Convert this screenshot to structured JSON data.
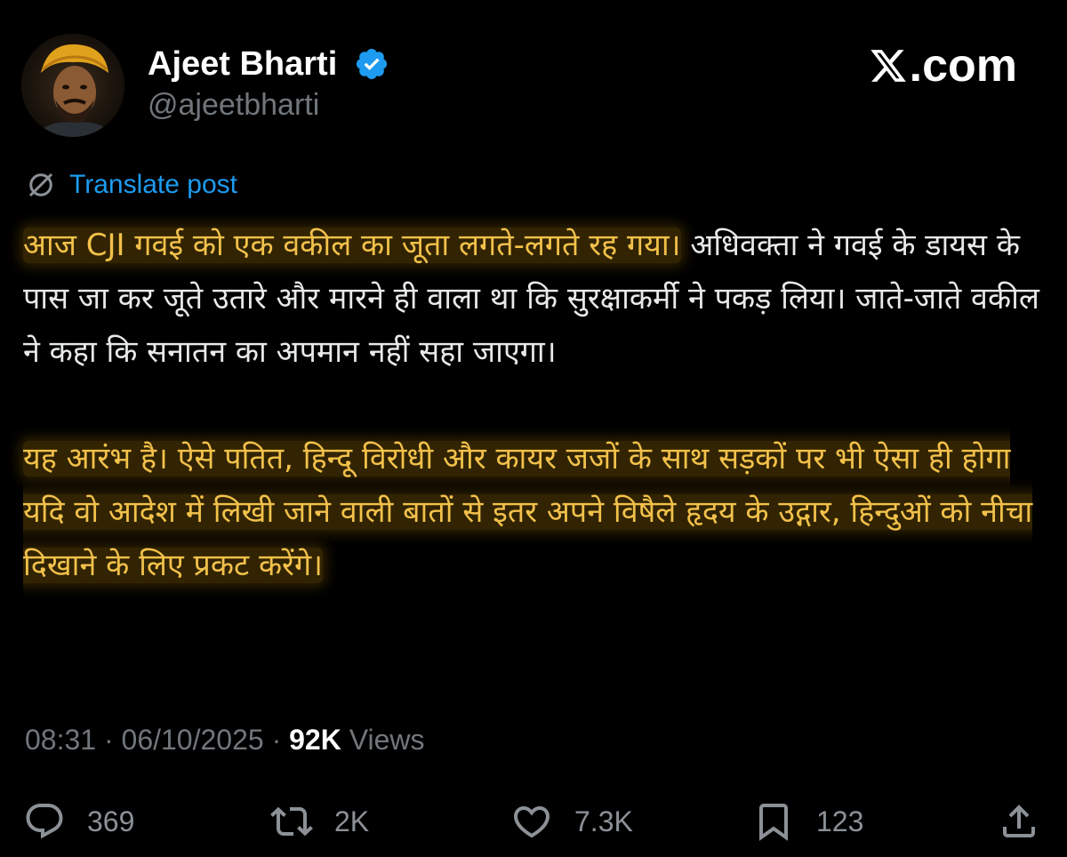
{
  "author": {
    "name": "Ajeet Bharti",
    "handle": "@ajeetbharti"
  },
  "brand": {
    "text": ".com"
  },
  "translate": {
    "label": "Translate post"
  },
  "post": {
    "para1": {
      "highlight": "आज CJI गवई को एक वकील का जूता लगते-लगते रह गया।",
      "rest": " अधिवक्ता ने गवई के डायस के पास जा कर जूते उतारे और मारने ही वाला था कि सुरक्षाकर्मी ने पकड़ लिया। जाते-जाते वकील ने कहा कि सनातन का अपमान नहीं सहा जाएगा।"
    },
    "para2": {
      "highlight": "यह आरंभ है। ऐसे पतित, हिन्दू विरोधी और कायर जजों के साथ सड़कों पर भी ऐसा ही होगा यदि वो आदेश में लिखी जाने वाली बातों से इतर अपने विषैले हृदय के उद्गार, हिन्दुओं को नीचा दिखाने के लिए प्रकट करेंगे।"
    }
  },
  "meta": {
    "time": "08:31",
    "separator": " · ",
    "date": "06/10/2025",
    "views_count": "92K",
    "views_label": " Views"
  },
  "actions": {
    "replies": "369",
    "reposts": "2K",
    "likes": "7.3K",
    "bookmarks": "123"
  },
  "colors": {
    "background": "#000000",
    "link": "#1d9bf0",
    "verified": "#1d9bf0",
    "highlight_text": "#f2c14b",
    "muted": "#71767b"
  },
  "icons": [
    "verified-badge-icon",
    "x-logo-icon",
    "translate-globe-icon",
    "reply-icon",
    "repost-icon",
    "like-icon",
    "bookmark-icon",
    "share-icon"
  ]
}
